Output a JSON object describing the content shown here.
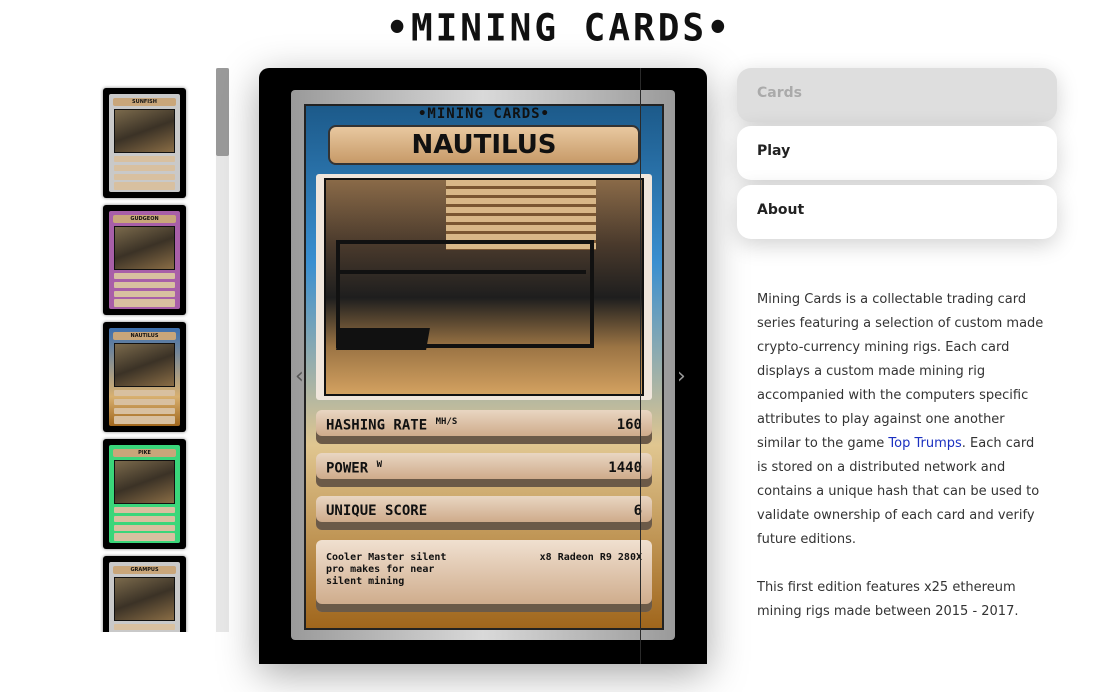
{
  "site": {
    "title": "•MINING CARDS•"
  },
  "thumbnails": [
    {
      "name": "SUNFISH",
      "border": "#000000",
      "inner": "#c9c9c9"
    },
    {
      "name": "GUDGEON",
      "border": "#000000",
      "inner": "#a85fa8"
    },
    {
      "name": "NAUTILUS",
      "border": "#000000",
      "inner": "#3d6fae"
    },
    {
      "name": "PIKE",
      "border": "#000000",
      "inner": "#3ad67a"
    },
    {
      "name": "GRAMPUS",
      "border": "#000000",
      "inner": "#c9c9c9"
    }
  ],
  "card": {
    "series": "•MINING CARDS•",
    "name": "NAUTILUS",
    "stats": [
      {
        "label": "HASHING RATE",
        "unit": "MH/S",
        "value": "160"
      },
      {
        "label": "POWER",
        "unit": "W",
        "value": "1440"
      },
      {
        "label": "UNIQUE SCORE",
        "unit": "",
        "value": "6"
      }
    ],
    "description": "Cooler Master silent pro makes for near silent mining",
    "extra": "x8 Radeon R9 280X"
  },
  "viewer": {
    "prev_icon": "chevron-left-icon",
    "next_icon": "chevron-right-icon",
    "prev_glyph": "‹",
    "next_glyph": "›"
  },
  "menu": {
    "cards": "Cards",
    "play": "Play",
    "about": "About"
  },
  "about": {
    "p1_before": "Mining Cards is a collectable trading card series featuring a selection of custom made crypto-currency mining rigs. Each card displays a custom made mining rig accompanied with the computers specific attributes to play against one another similar to the game ",
    "link": "Top Trumps",
    "p1_after": ". Each card is stored on a distributed network and contains a unique hash that can be used to validate ownership of each card and verify future editions.",
    "p2": "This first edition features x25 ethereum mining rigs made between 2015 - 2017."
  }
}
